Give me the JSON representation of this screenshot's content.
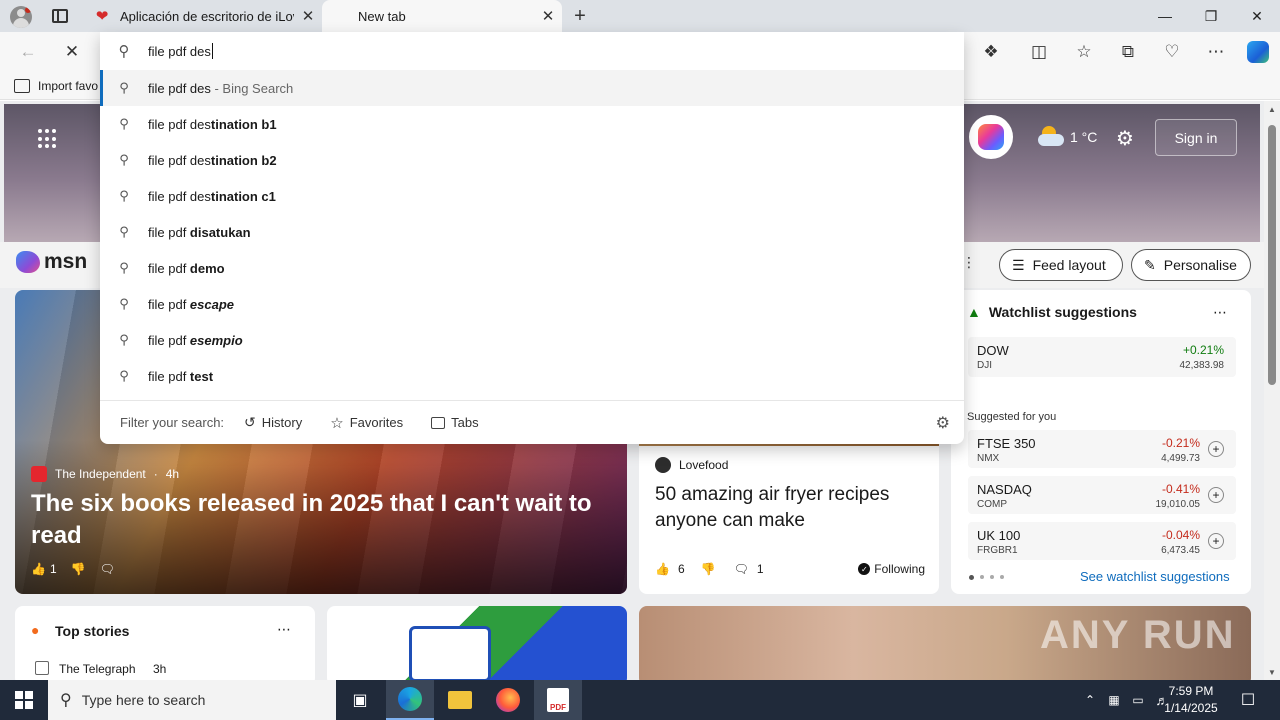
{
  "tabs": [
    {
      "title": "Aplicación de escritorio de iLovePDF"
    },
    {
      "title": "New tab"
    }
  ],
  "address": {
    "value": "file pdf des"
  },
  "favorites_bar": {
    "import_label": "Import favo"
  },
  "suggestions": [
    {
      "typed": "file pdf des",
      "completion": "",
      "suffix": " - Bing Search"
    },
    {
      "typed": "file pdf des",
      "completion": "tination b1"
    },
    {
      "typed": "file pdf des",
      "completion": "tination b2"
    },
    {
      "typed": "file pdf des",
      "completion": "tination c1"
    },
    {
      "typed": "file pdf ",
      "completion": "disatukan"
    },
    {
      "typed": "file pdf ",
      "completion": "demo"
    },
    {
      "typed": "file pdf ",
      "completion": "escape"
    },
    {
      "typed": "file pdf ",
      "completion": "esempio"
    },
    {
      "typed": "file pdf ",
      "completion": "test"
    }
  ],
  "filter": {
    "label": "Filter your search:",
    "history": "History",
    "favorites": "Favorites",
    "tabs": "Tabs"
  },
  "hero": {
    "weather": "1 °C",
    "sign_in": "Sign in"
  },
  "msn": {
    "logo": "msn",
    "feed_layout": "Feed layout",
    "personalise": "Personalise"
  },
  "main_story": {
    "source": "The Independent",
    "age": "4h",
    "headline": "The six books released in 2025 that I can't wait to read",
    "likes": "1"
  },
  "food_story": {
    "source": "Lovefood",
    "headline": "50 amazing air fryer recipes anyone can make",
    "likes": "6",
    "comments": "1",
    "following": "Following"
  },
  "watchlist": {
    "title": "Watchlist suggestions",
    "dow": {
      "name": "DOW",
      "sub": "DJI",
      "change": "+0.21%",
      "value": "42,383.98"
    },
    "suggested_label": "Suggested for you",
    "items": [
      {
        "name": "FTSE 350",
        "sub": "NMX",
        "change": "-0.21%",
        "value": "4,499.73"
      },
      {
        "name": "NASDAQ",
        "sub": "COMP",
        "change": "-0.41%",
        "value": "19,010.05"
      },
      {
        "name": "UK 100",
        "sub": "FRGBR1",
        "change": "-0.04%",
        "value": "6,473.45"
      }
    ],
    "see_more": "See watchlist suggestions"
  },
  "top_stories": {
    "title": "Top stories",
    "source": "The Telegraph",
    "age": "3h"
  },
  "taskbar": {
    "search_placeholder": "Type here to search",
    "time": "7:59 PM",
    "date": "1/14/2025"
  },
  "watermark": "ANY RUN",
  "colors": {
    "positive": "#107c10",
    "negative": "#c42b1c",
    "link": "#0f6cbd",
    "taskbar": "#202a3a"
  }
}
